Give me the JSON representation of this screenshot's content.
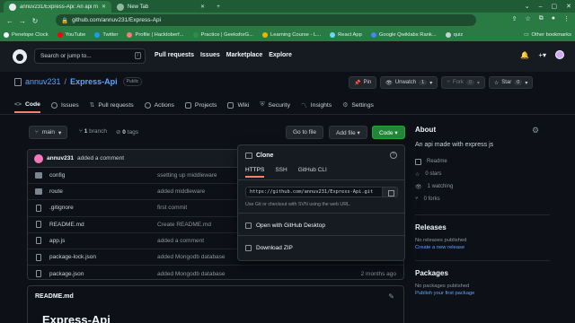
{
  "browser": {
    "tabs": [
      {
        "title": "annuv231/Express-Api: An api m",
        "active": true
      },
      {
        "title": "New Tab",
        "active": false
      }
    ],
    "url": "github.com/annuv231/Express-Api",
    "bookmarks": [
      "Penelope Clock",
      "YouTube",
      "Twitter",
      "Profile | Hacktoberf...",
      "Practice | GeeksforG...",
      "Learning Course - L...",
      "React App",
      "Google Qwiklabs Rank...",
      "quiz"
    ],
    "bookmark_dot_colors": [
      "#f0f6fc",
      "#ff0000",
      "#1d9bf0",
      "#ff7b72",
      "#2f8d46",
      "#f0b400",
      "#61dafb",
      "#4285f4",
      "#c9d1d9"
    ],
    "other_bookmarks": "Other bookmarks"
  },
  "github": {
    "search_placeholder": "Search or jump to...",
    "search_key": "/",
    "nav": [
      "Pull requests",
      "Issues",
      "Marketplace",
      "Explore"
    ]
  },
  "repo": {
    "owner": "annuv231",
    "separator": "/",
    "name": "Express-Api",
    "visibility": "Public",
    "pin_label": "Pin",
    "unwatch_label": "Unwatch",
    "watch_count": "1",
    "fork_label": "Fork",
    "fork_count": "0",
    "star_label": "Star",
    "star_count": "0",
    "tabs": [
      "Code",
      "Issues",
      "Pull requests",
      "Actions",
      "Projects",
      "Wiki",
      "Security",
      "Insights",
      "Settings"
    ],
    "branch": "main",
    "branch_count": "1",
    "branch_word": "branch",
    "tag_count": "0",
    "tag_word": "tags",
    "goto_file": "Go to file",
    "add_file": "Add file",
    "code": "Code"
  },
  "latest_commit": {
    "author": "annuv231",
    "message": "added a comment"
  },
  "files": [
    {
      "name": "config",
      "type": "dir",
      "message": "ssetting up middleware",
      "date": ""
    },
    {
      "name": "route",
      "type": "dir",
      "message": "added middleware",
      "date": ""
    },
    {
      "name": ".gitignore",
      "type": "file",
      "message": "first commit",
      "date": ""
    },
    {
      "name": "README.md",
      "type": "file",
      "message": "Create README.md",
      "date": ""
    },
    {
      "name": "app.js",
      "type": "file",
      "message": "added a comment",
      "date": ""
    },
    {
      "name": "package-lock.json",
      "type": "file",
      "message": "added Mongodb database",
      "date": ""
    },
    {
      "name": "package.json",
      "type": "file",
      "message": "added Mongodb database",
      "date": "2 months ago"
    }
  ],
  "readme": {
    "header": "README.md",
    "title": "Express-Api"
  },
  "clone": {
    "title": "Clone",
    "tabs": [
      "HTTPS",
      "SSH",
      "GitHub CLI"
    ],
    "url": "https://github.com/annuv231/Express-Api.git",
    "hint": "Use Git or checkout with SVN using the web URL.",
    "open_desktop": "Open with GitHub Desktop",
    "download_zip": "Download ZIP"
  },
  "about": {
    "heading": "About",
    "description": "An api made with express js",
    "readme": "Readme",
    "stars": "0 stars",
    "watching": "1 watching",
    "forks": "0 forks"
  },
  "releases": {
    "heading": "Releases",
    "none": "No releases published",
    "link": "Create a new release"
  },
  "packages": {
    "heading": "Packages",
    "none": "No packages published",
    "link": "Publish your first package"
  }
}
